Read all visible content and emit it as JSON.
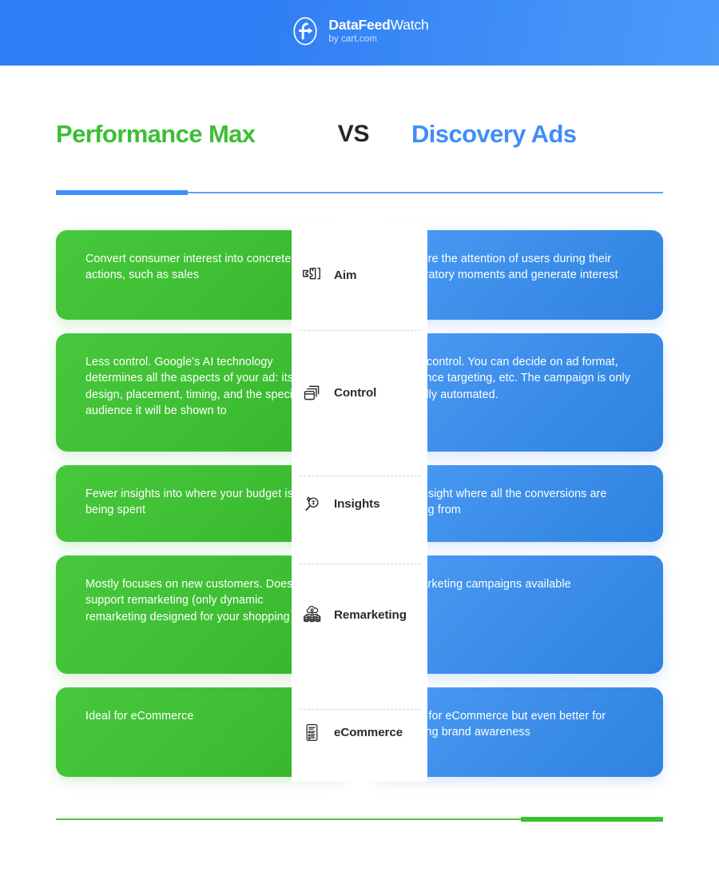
{
  "header": {
    "logo_icon": "datafeedwatch-f-logo-icon",
    "brand_bold": "DataFeed",
    "brand_light": "Watch",
    "tagline": "by cart.com",
    "bg_gradient_from": "#2f7df4",
    "bg_gradient_to": "#4a9bfa"
  },
  "title": {
    "left": "Performance Max",
    "vs": "VS",
    "right": "Discovery Ads",
    "left_color": "#3cbf33",
    "vs_color": "#262626",
    "right_color": "#3d8ef8"
  },
  "dividers": {
    "top_color": "#3d8ef8",
    "top_thin_color": "#5fa3f9",
    "bottom_color": "#3cbf33",
    "bottom_thin_color": "#4cc93f"
  },
  "comparison": {
    "left_color": "#3fbf33",
    "right_color": "#3b8de9",
    "rows": [
      {
        "label": "Aim",
        "icon": "puzzle-piece-icon",
        "left": "Convert consumer interest into concrete actions, such as sales",
        "right": "Capture the attention of users during their exploratory moments and generate interest"
      },
      {
        "label": "Control",
        "icon": "stacked-windows-icon",
        "left": "Less control. Google’s AI technology determines all the aspects of your ad: its design, placement, timing, and the specific audience it will be shown to",
        "right": "More control. You can decide on ad format, audience targeting, etc. The campaign is only partially automated."
      },
      {
        "label": "Insights",
        "icon": "magnifying-glass-gear-icon",
        "left": "Fewer insights into where your budget is being spent",
        "right": "Full insight where all the conversions are coming from"
      },
      {
        "label": "Remarketing",
        "icon": "cloud-servers-icon",
        "left": "Mostly focuses on new customers. Doesn’t support remarketing (only dynamic remarketing designed for your shopping feed)",
        "right": "Remarketing campaigns available"
      },
      {
        "label": "eCommerce",
        "icon": "list-document-icon",
        "left": "Ideal for eCommerce",
        "right": "Good for eCommerce but even better for creating brand awareness"
      }
    ]
  }
}
